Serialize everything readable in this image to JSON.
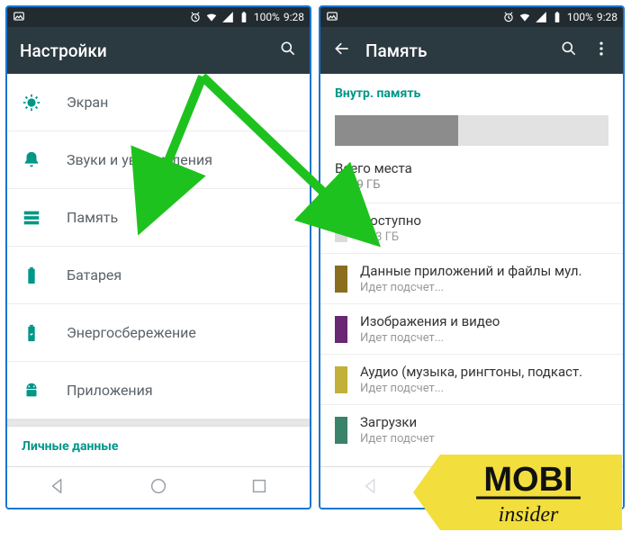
{
  "status": {
    "battery_pct": "100%",
    "time": "9:28"
  },
  "left_screen": {
    "title": "Настройки",
    "items": [
      {
        "label": "Экран"
      },
      {
        "label": "Звуки и уведомления"
      },
      {
        "label": "Память"
      },
      {
        "label": "Батарея"
      },
      {
        "label": "Энергосбережение"
      },
      {
        "label": "Приложения"
      }
    ],
    "section": "Личные данные"
  },
  "right_screen": {
    "title": "Память",
    "section": "Внутр. память",
    "total_label": "Всего места",
    "total_value": "11,99 ГБ",
    "avail_label": "Доступно",
    "avail_value": "6,63 ГБ",
    "categories": [
      {
        "color": "#8a6d1f",
        "title": "Данные приложений и файлы мул.",
        "sub": "Идет подсчет..."
      },
      {
        "color": "#6a2773",
        "title": "Изображения и видео",
        "sub": "Идет подсчет..."
      },
      {
        "color": "#c2b03b",
        "title": "Аудио (музыка, рингтоны, подкаст.",
        "sub": "Идет подсчет..."
      },
      {
        "color": "#3a826a",
        "title": "Загрузки",
        "sub": "Идет подсчет"
      }
    ]
  },
  "logo": {
    "line1": "MOBI",
    "line2": "insider"
  }
}
